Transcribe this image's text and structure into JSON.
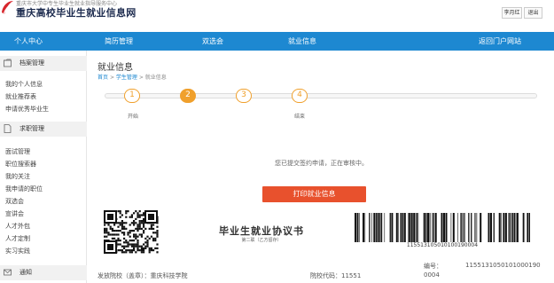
{
  "header": {
    "subtitle": "重庆市大学中专生毕业生就业指导服务中心",
    "title": "重庆高校毕业生就业信息网",
    "user_name": "李月红",
    "logout_label": "退出"
  },
  "nav": {
    "items": [
      "个人中心",
      "简历管理",
      "双选会",
      "就业信息",
      "返回门户网站"
    ]
  },
  "sidebar": {
    "sections": [
      {
        "title": "档案管理",
        "icon": "folder-icon",
        "links": [
          "我的个人信息",
          "就业推荐表",
          "申请优秀毕业生"
        ]
      },
      {
        "title": "求职管理",
        "icon": "document-icon",
        "links": [
          "面试管理",
          "职位搜索器",
          "我的关注",
          "我申请的职位",
          "双选会",
          "宣讲会",
          "人才外包",
          "人才定制",
          "实习实践"
        ]
      },
      {
        "title": "通知",
        "icon": "mail-icon",
        "links": []
      }
    ]
  },
  "main": {
    "title": "就业信息",
    "breadcrumb": [
      "首页",
      "学生管理",
      "就业信息"
    ],
    "breadcrumb_sep": ">",
    "steps": [
      {
        "num": "1",
        "label": "开始",
        "active": false
      },
      {
        "num": "2",
        "label": "",
        "active": true
      },
      {
        "num": "3",
        "label": "",
        "active": false
      },
      {
        "num": "4",
        "label": "结束",
        "active": false
      }
    ],
    "status_text": "您已提交签约申请，正在审核中。",
    "print_button": "打印就业信息",
    "doc_title": "毕业生就业协议书",
    "doc_subtitle": "第二联（乙方留存）",
    "barcode_number": "115513105010100190004",
    "school_label": "发放院校（盖章）：重庆科技学院",
    "school_code_label": "院校代码：11551",
    "serial_label": "编号：",
    "serial_value": "1155131050101000190",
    "serial_tail": "0004"
  },
  "colors": {
    "nav_bg": "#1d88d1",
    "accent_orange": "#f0a02c",
    "button_red": "#e8512d",
    "title_navy": "#1f2d50"
  }
}
